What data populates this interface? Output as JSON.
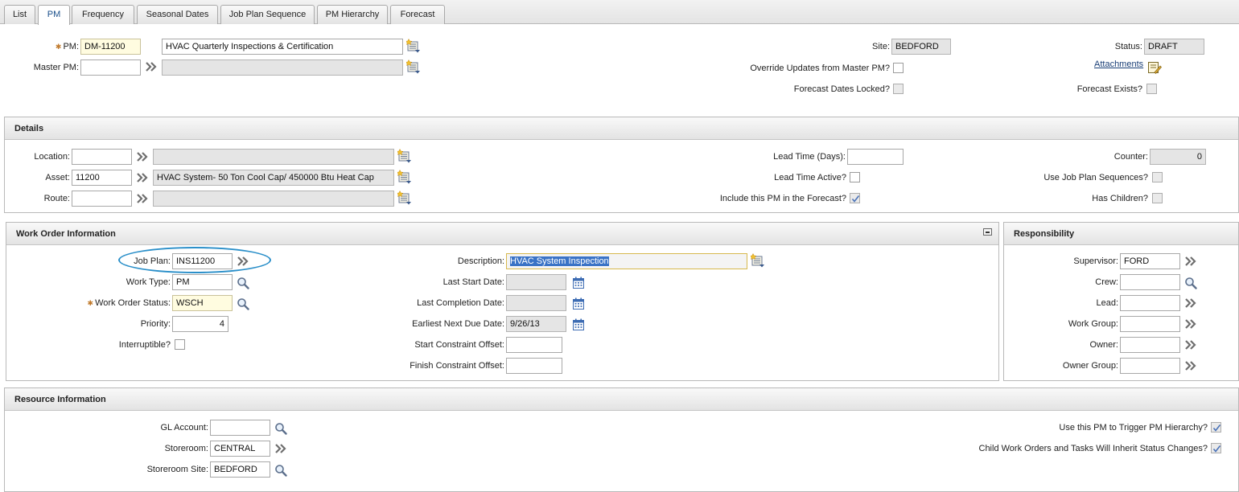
{
  "tabs": [
    "List",
    "PM",
    "Frequency",
    "Seasonal Dates",
    "Job Plan Sequence",
    "PM Hierarchy",
    "Forecast"
  ],
  "header": {
    "pm_label": "PM:",
    "pm_value": "DM-11200",
    "pm_description": "HVAC Quarterly Inspections & Certification",
    "master_pm_label": "Master PM:",
    "master_pm_value": "",
    "master_pm_description": "",
    "site_label": "Site:",
    "site_value": "BEDFORD",
    "status_label": "Status:",
    "status_value": "DRAFT",
    "override_label": "Override Updates from Master PM?",
    "attachments_label": "Attachments",
    "forecast_locked_label": "Forecast Dates Locked?",
    "forecast_exists_label": "Forecast Exists?"
  },
  "details": {
    "title": "Details",
    "location_label": "Location:",
    "location_value": "",
    "location_description": "",
    "asset_label": "Asset:",
    "asset_value": "11200",
    "asset_description": "HVAC System- 50 Ton Cool Cap/ 450000 Btu Heat Cap",
    "route_label": "Route:",
    "route_value": "",
    "route_description": "",
    "lead_time_label": "Lead Time (Days):",
    "lead_time_value": "",
    "lead_time_active_label": "Lead Time Active?",
    "include_forecast_label": "Include this PM in the Forecast?",
    "counter_label": "Counter:",
    "counter_value": "0",
    "use_jp_seq_label": "Use Job Plan Sequences?",
    "has_children_label": "Has Children?"
  },
  "work_order": {
    "title": "Work Order Information",
    "job_plan_label": "Job Plan:",
    "job_plan_value": "INS11200",
    "work_type_label": "Work Type:",
    "work_type_value": "PM",
    "wo_status_label": "Work Order Status:",
    "wo_status_value": "WSCH",
    "priority_label": "Priority:",
    "priority_value": "4",
    "interruptible_label": "Interruptible?",
    "description_label": "Description:",
    "description_value": "HVAC System Inspection",
    "last_start_label": "Last Start Date:",
    "last_start_value": "",
    "last_completion_label": "Last Completion Date:",
    "last_completion_value": "",
    "earliest_next_label": "Earliest Next Due Date:",
    "earliest_next_value": "9/26/13",
    "start_constraint_label": "Start Constraint Offset:",
    "start_constraint_value": "",
    "finish_constraint_label": "Finish Constraint Offset:",
    "finish_constraint_value": ""
  },
  "responsibility": {
    "title": "Responsibility",
    "supervisor_label": "Supervisor:",
    "supervisor_value": "FORD",
    "crew_label": "Crew:",
    "crew_value": "",
    "lead_label": "Lead:",
    "lead_value": "",
    "work_group_label": "Work Group:",
    "work_group_value": "",
    "owner_label": "Owner:",
    "owner_value": "",
    "owner_group_label": "Owner Group:",
    "owner_group_value": ""
  },
  "resource": {
    "title": "Resource Information",
    "gl_label": "GL Account:",
    "gl_value": "",
    "storeroom_label": "Storeroom:",
    "storeroom_value": "CENTRAL",
    "storeroom_site_label": "Storeroom Site:",
    "storeroom_site_value": "BEDFORD",
    "trigger_label": "Use this PM to Trigger PM Hierarchy?",
    "inherit_label": "Child Work Orders and Tasks Will Inherit Status Changes?"
  },
  "colors": {
    "tab_active_text": "#1a4f8b",
    "highlight_selection": "#3a73c6",
    "callout_ellipse": "#2a8fc9",
    "required_marker": "#c07a2c"
  },
  "icons": [
    "detail-menu-icon",
    "chevron-double-right-icon",
    "magnifier-icon",
    "calendar-icon",
    "attachments-icon",
    "minimize-icon"
  ]
}
